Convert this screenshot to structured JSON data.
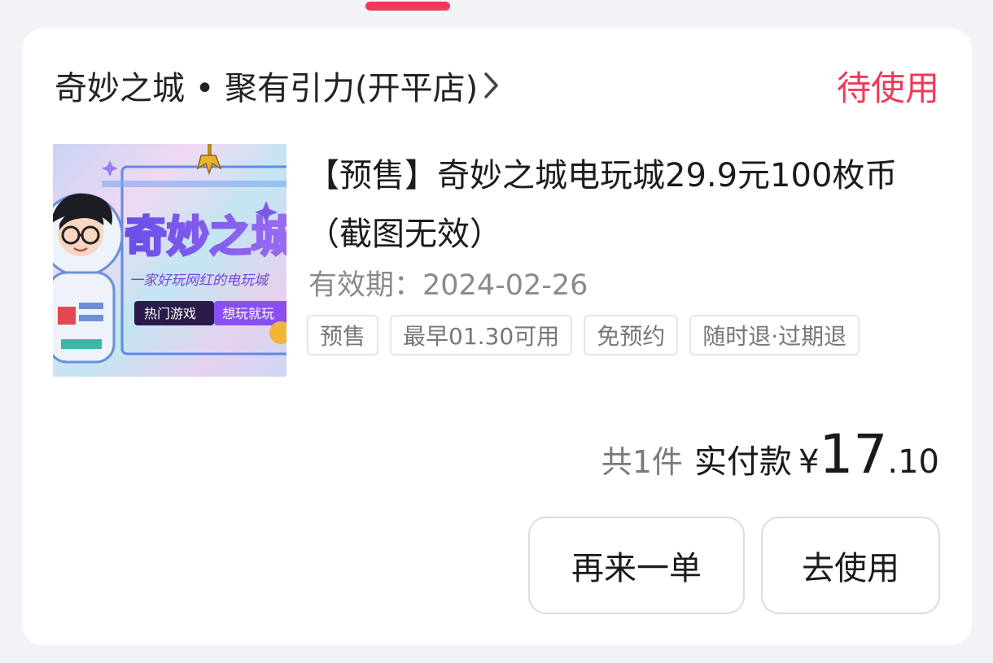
{
  "order": {
    "shop_name": "奇妙之城 • 聚有引力(开平店)",
    "status": "待使用",
    "product_title": "【预售】奇妙之城电玩城29.9元100枚币（截图无效）",
    "validity_label": "有效期：",
    "validity_date": "2024-02-26",
    "tags": [
      "预售",
      "最早01.30可用",
      "免预约",
      "随时退·过期退"
    ],
    "item_count": "共1件",
    "pay_label": "实付款",
    "currency": "¥",
    "price_integer": "17",
    "price_decimal": ".10"
  },
  "thumbnail": {
    "logo_text": "奇妙之城",
    "slogan": "一家好玩网红的电玩城",
    "tag_left": "热门游戏",
    "tag_right": "想玩就玩"
  },
  "buttons": {
    "reorder": "再来一单",
    "use": "去使用"
  },
  "colors": {
    "accent": "#ee3b57",
    "background": "#f2f3f7",
    "card": "#ffffff"
  }
}
